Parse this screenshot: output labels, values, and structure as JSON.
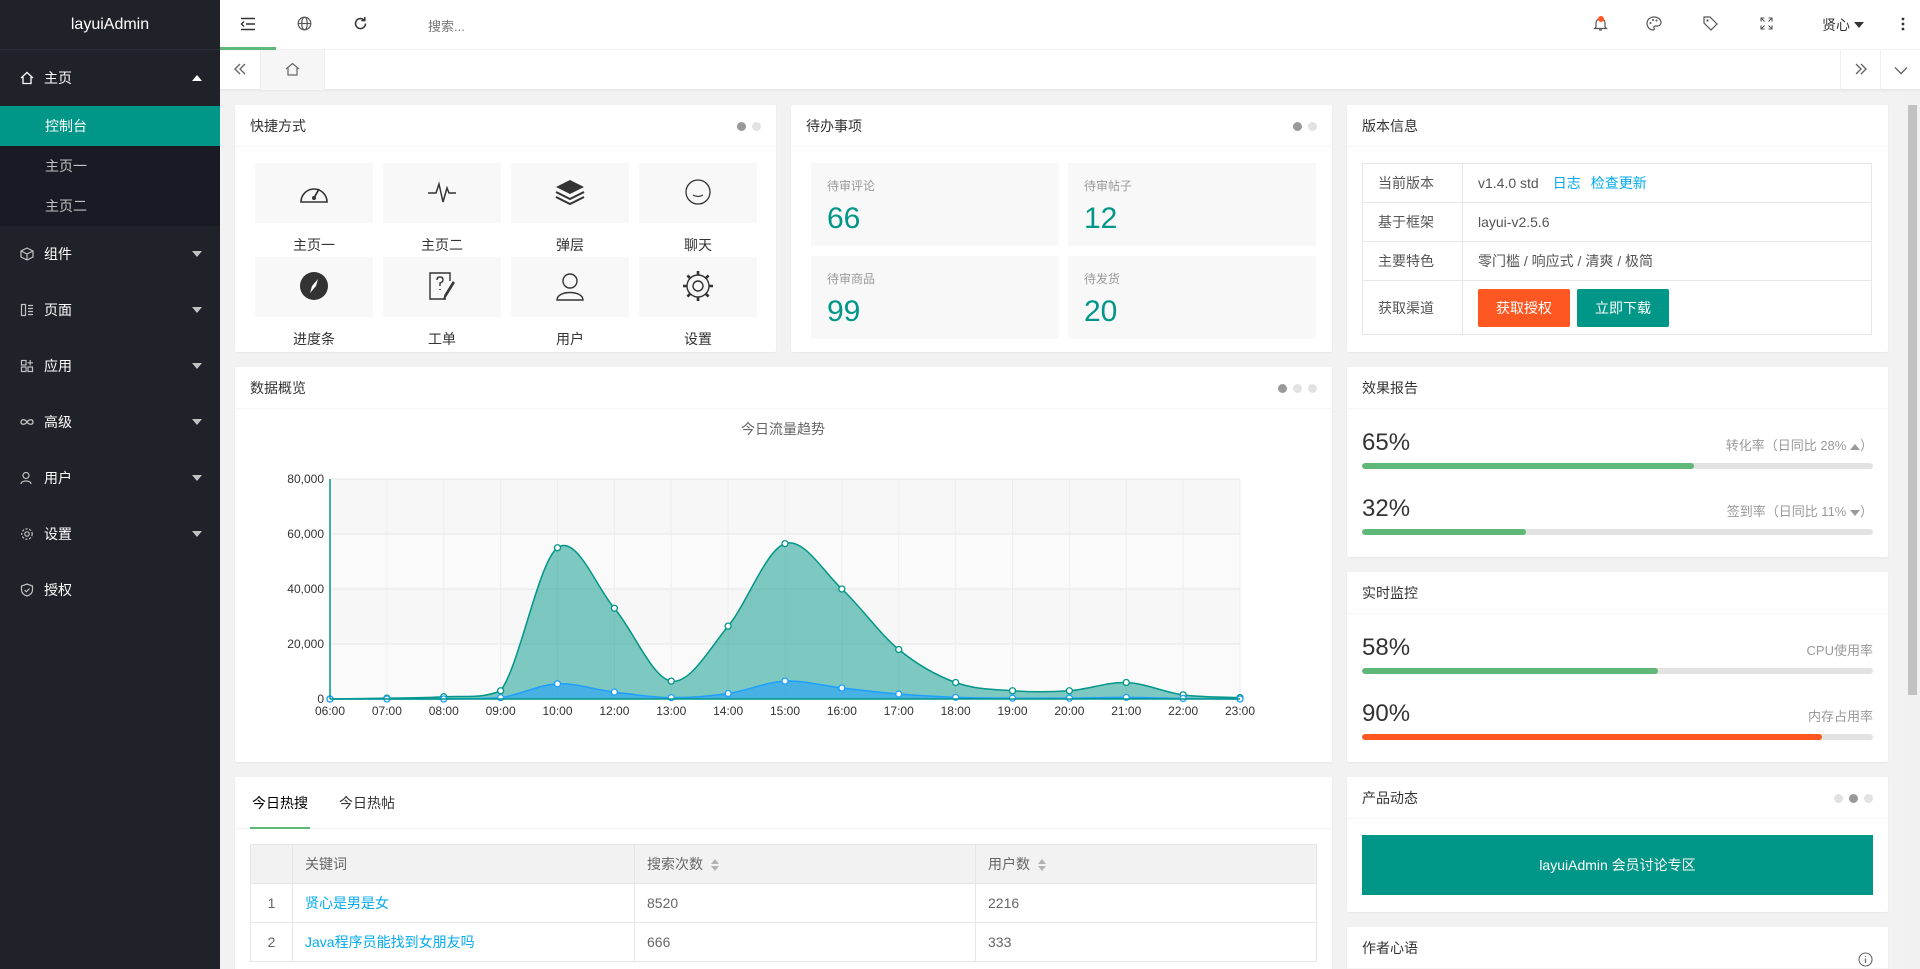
{
  "sidebar": {
    "logo": "layuiAdmin",
    "home": {
      "label": "主页",
      "subs": [
        "控制台",
        "主页一",
        "主页二"
      ]
    },
    "items": [
      {
        "label": "组件",
        "icon": "cube-icon"
      },
      {
        "label": "页面",
        "icon": "template-icon"
      },
      {
        "label": "应用",
        "icon": "app-icon"
      },
      {
        "label": "高级",
        "icon": "infinity-icon"
      },
      {
        "label": "用户",
        "icon": "user-icon"
      },
      {
        "label": "设置",
        "icon": "gear-icon"
      },
      {
        "label": "授权",
        "icon": "shield-icon"
      }
    ]
  },
  "header": {
    "search_placeholder": "搜索...",
    "user": "贤心"
  },
  "shortcuts": {
    "title": "快捷方式",
    "items": [
      {
        "label": "主页一",
        "icon": "dashboard-icon"
      },
      {
        "label": "主页二",
        "icon": "pulse-icon"
      },
      {
        "label": "弹层",
        "icon": "layers-icon"
      },
      {
        "label": "聊天",
        "icon": "chat-icon"
      },
      {
        "label": "进度条",
        "icon": "compass-icon"
      },
      {
        "label": "工单",
        "icon": "form-icon"
      },
      {
        "label": "用户",
        "icon": "user-icon"
      },
      {
        "label": "设置",
        "icon": "gear-icon"
      }
    ]
  },
  "todo": {
    "title": "待办事项",
    "items": [
      {
        "label": "待审评论",
        "value": "66"
      },
      {
        "label": "待审帖子",
        "value": "12"
      },
      {
        "label": "待审商品",
        "value": "99"
      },
      {
        "label": "待发货",
        "value": "20"
      }
    ]
  },
  "version": {
    "title": "版本信息",
    "rows": [
      {
        "key": "当前版本",
        "value": "v1.4.0 std",
        "link1": "日志",
        "link2": "检查更新"
      },
      {
        "key": "基于框架",
        "value": "layui-v2.5.6"
      },
      {
        "key": "主要特色",
        "value": "零门槛 / 响应式 / 清爽 / 极简"
      },
      {
        "key": "获取渠道",
        "btn1": "获取授权",
        "btn2": "立即下载"
      }
    ]
  },
  "overview": {
    "title": "数据概览"
  },
  "chart_data": {
    "type": "area",
    "title": "今日流量趋势",
    "categories": [
      "06:00",
      "07:00",
      "08:00",
      "09:00",
      "10:00",
      "12:00",
      "13:00",
      "14:00",
      "15:00",
      "16:00",
      "17:00",
      "18:00",
      "19:00",
      "20:00",
      "21:00",
      "22:00",
      "23:00"
    ],
    "series": [
      {
        "values": [
          0,
          300,
          800,
          3000,
          55000,
          33000,
          6500,
          26500,
          56500,
          40000,
          18000,
          6000,
          3000,
          3000,
          6000,
          1500,
          500
        ],
        "color": "#2ec7c9"
      },
      {
        "values": [
          0,
          0,
          0,
          500,
          5500,
          2500,
          500,
          2000,
          6500,
          4000,
          1800,
          600,
          300,
          300,
          600,
          200,
          0
        ],
        "color": "#b6a2de"
      }
    ],
    "ylim": [
      0,
      80000
    ],
    "yticks": [
      "0",
      "20,000",
      "40,000",
      "60,000",
      "80,000"
    ],
    "grid": true
  },
  "report": {
    "title": "效果报告",
    "rows": [
      {
        "value": "65%",
        "label": "转化率（日同比 28%",
        "pct": 65,
        "color": "#5fb878",
        "trend": "up"
      },
      {
        "value": "32%",
        "label": "签到率（日同比 11%",
        "pct": 32,
        "color": "#5fb878",
        "trend": "down"
      }
    ]
  },
  "monitor": {
    "title": "实时监控",
    "rows": [
      {
        "value": "58%",
        "label": "CPU使用率",
        "pct": 58,
        "color": "#5fb878"
      },
      {
        "value": "90%",
        "label": "内存占用率",
        "pct": 90,
        "color": "#ff5722"
      }
    ]
  },
  "hot": {
    "tabs": [
      "今日热搜",
      "今日热帖"
    ],
    "headers": [
      "关键词",
      "搜索次数",
      "用户数"
    ],
    "rows": [
      {
        "n": "1",
        "k": "贤心是男是女",
        "c": "8520",
        "u": "2216"
      },
      {
        "n": "2",
        "k": "Java程序员能找到女朋友吗",
        "c": "666",
        "u": "333"
      }
    ]
  },
  "product": {
    "title": "产品动态",
    "banner": "layuiAdmin 会员讨论专区"
  },
  "author": {
    "title": "作者心语"
  },
  "colors": {
    "accent": "#009688",
    "orange": "#ff5722",
    "link": "#01aaed",
    "sidebar": "#20222a"
  }
}
